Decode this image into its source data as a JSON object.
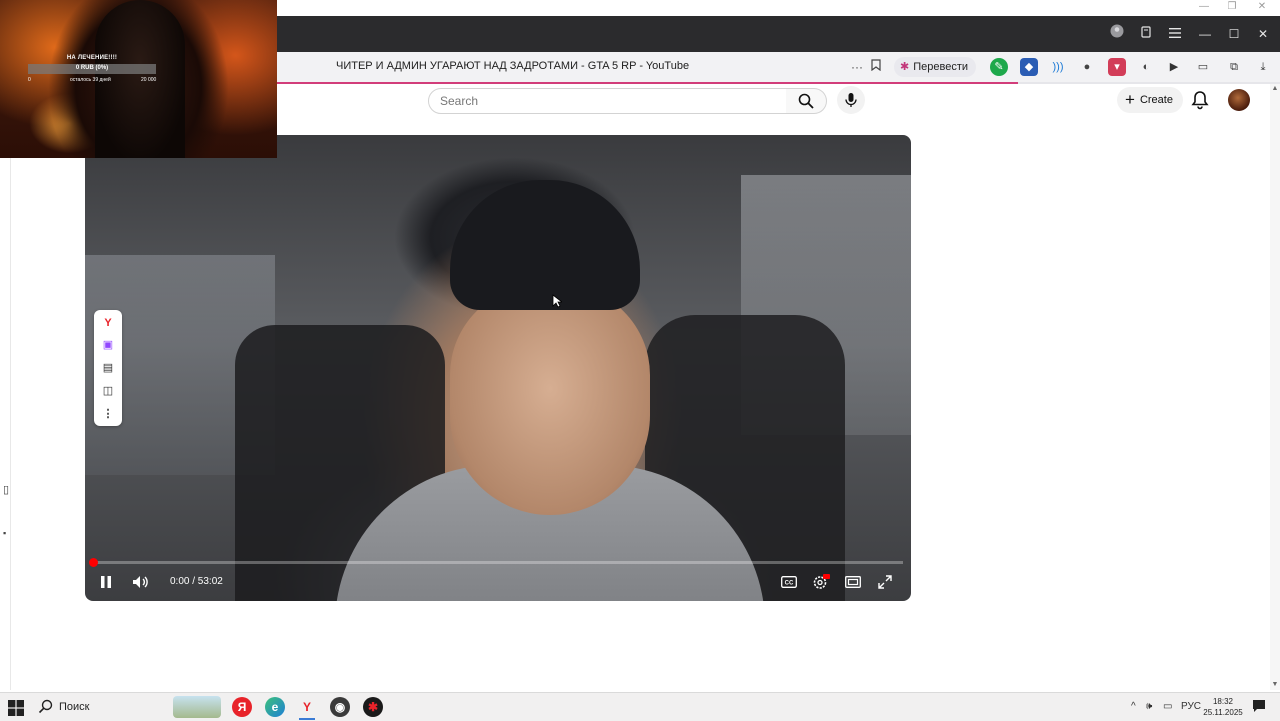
{
  "browser": {
    "tab_title": "ЧИТЕР И АДМИН УГАРАЮТ НАД ЗАДРОТАМИ - GTA 5 RP - YouTube",
    "translate_label": "Перевести"
  },
  "header": {
    "search_placeholder": "Search",
    "create_label": "Create"
  },
  "player": {
    "time_display": "0:00 / 53:02",
    "progress": 0.0
  },
  "overlay": {
    "goal_title": "НА ЛЕЧЕНИЕ!!!!",
    "goal_amount": "0 RUB (0%)",
    "goal_min": "0",
    "goal_remaining": "осталось 39 дней",
    "goal_max": "20 000"
  },
  "taskbar": {
    "search_label": "Поиск",
    "language": "РУС",
    "time": "18:32",
    "date": "25.11.2025"
  },
  "colors": {
    "accent_line": "#d23d7a",
    "progress_red": "#ff0000",
    "taskbar_bg": "#f1f0f0",
    "browser_bar": "#2b2b2d"
  },
  "icons": {
    "yandex_panel": [
      "yandex-y-icon",
      "twitch-chat-icon",
      "subtitles-icon",
      "pip-icon",
      "more-vertical-icon"
    ]
  }
}
